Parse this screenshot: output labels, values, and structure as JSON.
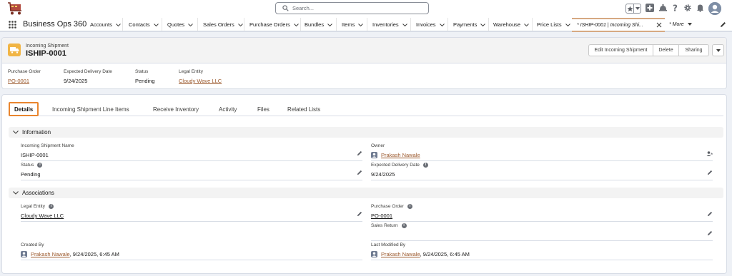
{
  "topbar": {
    "search_placeholder": "Search...",
    "icons": [
      "favorites-star-icon",
      "add-icon",
      "setup-assistant-icon",
      "help-icon",
      "settings-gear-icon",
      "notifications-bell-icon",
      "user-avatar"
    ]
  },
  "nav": {
    "app_name": "Business Ops 360",
    "items": [
      "Accounts",
      "Contacts",
      "Quotes",
      "Sales Orders",
      "Purchase Orders",
      "Bundles",
      "Items",
      "Inventories",
      "Invoices",
      "Payments",
      "Warehouse",
      "Price Lists"
    ],
    "active_tab": "* ISHIP-0001 | Incoming Shi...",
    "more": "* More"
  },
  "record": {
    "type": "Incoming Shipment",
    "title": "ISHIP-0001",
    "buttons": {
      "edit": "Edit Incoming Shipment",
      "delete": "Delete",
      "sharing": "Sharing"
    },
    "highlights": [
      {
        "label": "Purchase Order",
        "value": "PO-0001"
      },
      {
        "label": "Expected Delivery Date",
        "value": "9/24/2025"
      },
      {
        "label": "Status",
        "value": "Pending"
      },
      {
        "label": "Legal Entity",
        "value": "Cloudy Wave LLC"
      }
    ]
  },
  "tabs": [
    "Details",
    "Incoming Shipment Line Items",
    "Receive Inventory",
    "Activity",
    "Files",
    "Related Lists"
  ],
  "sections": {
    "information": {
      "title": "Information",
      "fields": {
        "name": {
          "label": "Incoming Shipment Name",
          "value": "ISHIP-0001"
        },
        "owner": {
          "label": "Owner",
          "value": "Prakash Nawale"
        },
        "status": {
          "label": "Status",
          "value": "Pending"
        },
        "expected_date": {
          "label": "Expected Delivery Date",
          "value": "9/24/2025"
        }
      }
    },
    "associations": {
      "title": "Associations",
      "fields": {
        "legal_entity": {
          "label": "Legal Entity",
          "value": "Cloudy Wave LLC"
        },
        "purchase_order": {
          "label": "Purchase Order",
          "value": "PO-0001"
        },
        "sales_return": {
          "label": "Sales Return",
          "value": ""
        },
        "created_by": {
          "label": "Created By",
          "user": "Prakash Nawale",
          "date": ", 9/24/2025, 6:45 AM"
        },
        "modified_by": {
          "label": "Last Modified By",
          "user": "Prakash Nawale",
          "date": ", 9/24/2025, 6:45 AM"
        }
      }
    }
  },
  "colors": {
    "accent": "#e9852e",
    "link": "#9c5a2e",
    "record_icon": "#f1b545"
  }
}
